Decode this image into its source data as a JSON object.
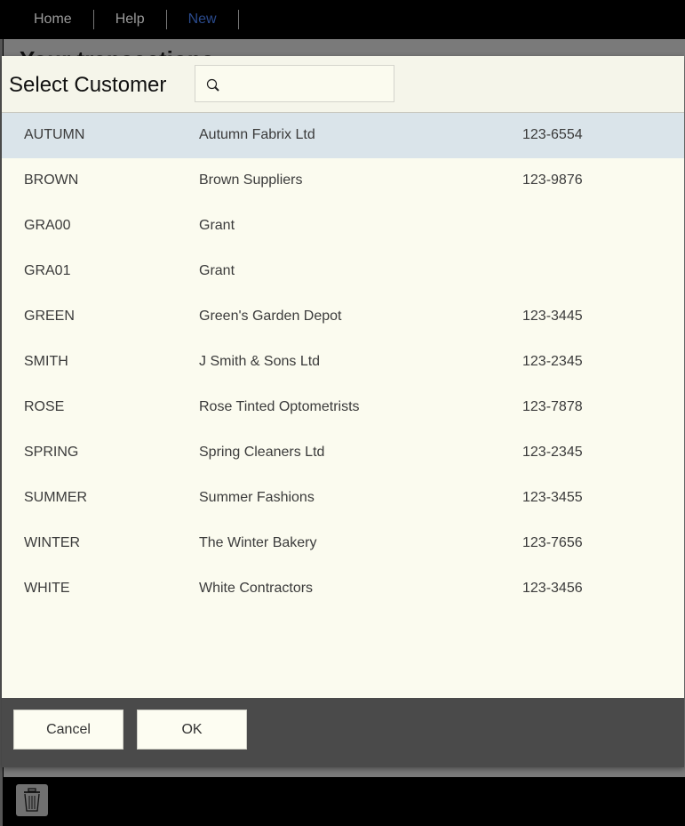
{
  "nav": {
    "items": [
      {
        "label": "Home",
        "active": false
      },
      {
        "label": "Help",
        "active": false
      },
      {
        "label": "New",
        "active": true
      }
    ]
  },
  "background": {
    "page_title": "Your transactions"
  },
  "dialog": {
    "title": "Select Customer",
    "search": {
      "value": "",
      "placeholder": "",
      "icon": "search-icon"
    },
    "customers": [
      {
        "code": "AUTUMN",
        "name": "Autumn Fabrix Ltd",
        "phone": "123-6554",
        "selected": true
      },
      {
        "code": "BROWN",
        "name": "Brown Suppliers",
        "phone": "123-9876",
        "selected": false
      },
      {
        "code": "GRA00",
        "name": "Grant",
        "phone": "",
        "selected": false
      },
      {
        "code": "GRA01",
        "name": "Grant",
        "phone": "",
        "selected": false
      },
      {
        "code": "GREEN",
        "name": "Green's Garden Depot",
        "phone": "123-3445",
        "selected": false
      },
      {
        "code": "SMITH",
        "name": "J Smith & Sons Ltd",
        "phone": "123-2345",
        "selected": false
      },
      {
        "code": "ROSE",
        "name": "Rose Tinted Optometrists",
        "phone": "123-7878",
        "selected": false
      },
      {
        "code": "SPRING",
        "name": "Spring Cleaners Ltd",
        "phone": "123-2345",
        "selected": false
      },
      {
        "code": "SUMMER",
        "name": "Summer Fashions",
        "phone": "123-3455",
        "selected": false
      },
      {
        "code": "WINTER",
        "name": "The Winter Bakery",
        "phone": "123-7656",
        "selected": false
      },
      {
        "code": "WHITE",
        "name": "White Contractors",
        "phone": "123-3456",
        "selected": false
      }
    ],
    "buttons": {
      "cancel": "Cancel",
      "ok": "OK"
    }
  },
  "bottom_bar": {
    "icon": "trash-icon"
  },
  "colors": {
    "selected_row": "#dae4ea",
    "active_nav": "#2a4a8c",
    "dialog_bg": "#fbfbef"
  }
}
